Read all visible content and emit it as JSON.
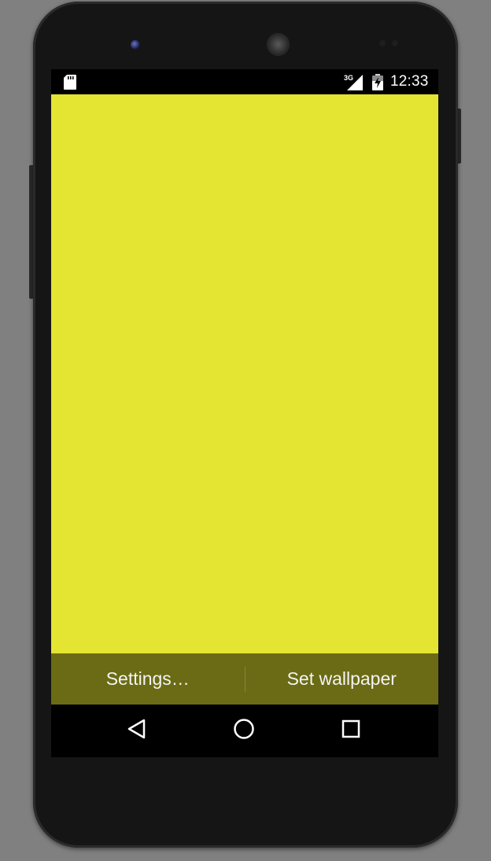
{
  "status_bar": {
    "network_type": "3G",
    "time": "12:33",
    "icons": [
      "sd-card-icon",
      "signal-3g-icon",
      "battery-charging-icon"
    ]
  },
  "wallpaper": {
    "color": "#E3E532"
  },
  "action_bar": {
    "background": "#6B6B16",
    "settings_label": "Settings…",
    "set_wallpaper_label": "Set wallpaper"
  },
  "nav_bar": {
    "icons": [
      "back-icon",
      "home-icon",
      "recents-icon"
    ]
  }
}
